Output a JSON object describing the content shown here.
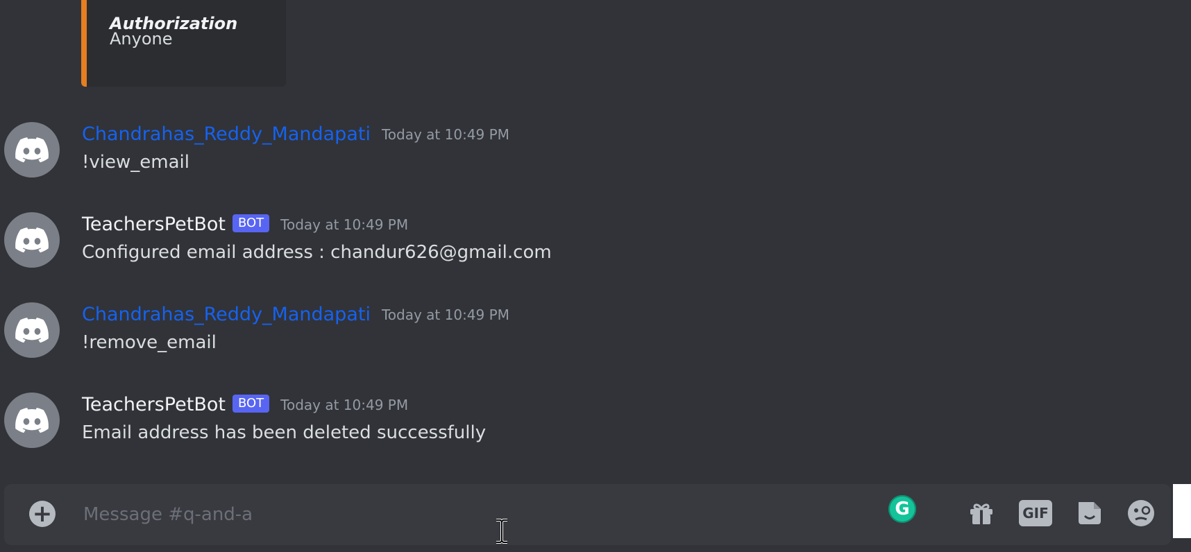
{
  "embed": {
    "field_name": "Authorization",
    "field_value": "Anyone",
    "accent_color": "#e67e22"
  },
  "messages": [
    {
      "author": "Chandrahas_Reddy_Mandapati",
      "author_type": "user",
      "timestamp": "Today at 10:49 PM",
      "content": "!view_email"
    },
    {
      "author": "TeachersPetBot",
      "author_type": "bot",
      "bot_tag": "BOT",
      "timestamp": "Today at 10:49 PM",
      "content": "Configured email address : chandur626@gmail.com"
    },
    {
      "author": "Chandrahas_Reddy_Mandapati",
      "author_type": "user",
      "timestamp": "Today at 10:49 PM",
      "content": "!remove_email"
    },
    {
      "author": "TeachersPetBot",
      "author_type": "bot",
      "bot_tag": "BOT",
      "timestamp": "Today at 10:49 PM",
      "content": "Email address has been deleted successfully"
    }
  ],
  "composer": {
    "placeholder": "Message #q-and-a",
    "add_icon": "plus-circle-icon",
    "grammarly_label": "G",
    "gif_label": "GIF",
    "icons": [
      "gift-icon",
      "gif-icon",
      "sticker-icon",
      "emoji-icon"
    ]
  },
  "colors": {
    "background": "#313338",
    "user_name": "#1662f0",
    "bot_tag": "#5865f2",
    "timestamp": "#949ba4"
  }
}
